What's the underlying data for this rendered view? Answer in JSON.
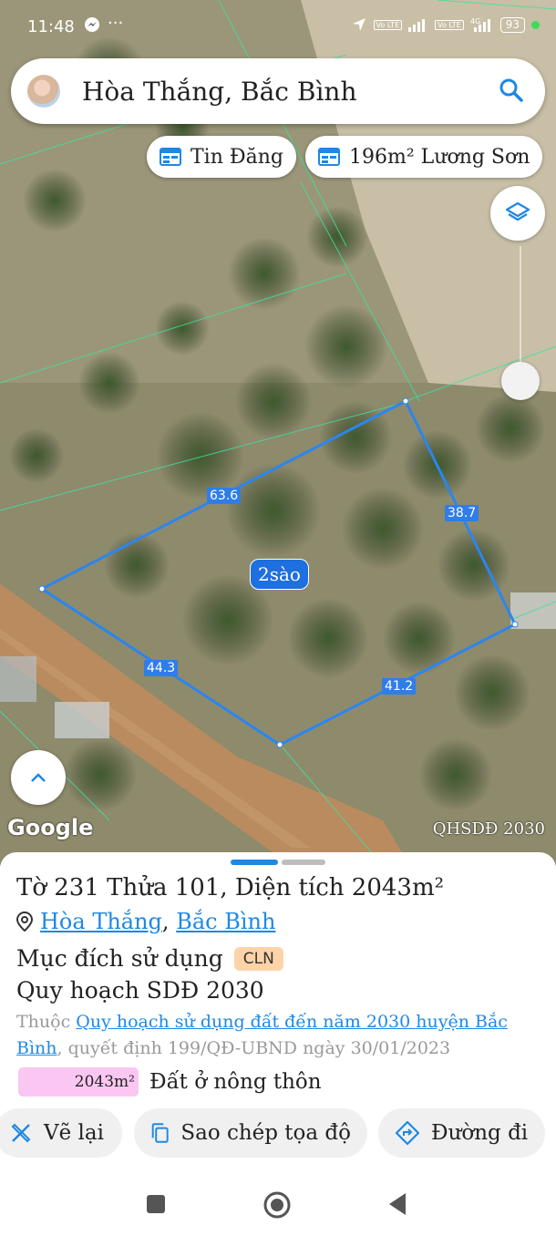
{
  "status_bar": {
    "time": "11:48",
    "battery": "93"
  },
  "search": {
    "query": "Hòa Thắng, Bắc Bình"
  },
  "chips": [
    {
      "label": "Tin Đăng"
    },
    {
      "label": "196m² Lương Sơn"
    }
  ],
  "map": {
    "edges": [
      "63.6",
      "38.7",
      "44.3",
      "41.2"
    ],
    "area_label": "2sào",
    "attribution": "Google",
    "layer_name": "QHSDĐ 2030"
  },
  "parcel": {
    "title": "Tờ 231 Thửa 101, Diện tích 2043m²",
    "commune": "Hòa Thắng",
    "separator": ",",
    "district": "Bắc Bình",
    "purpose_label": "Mục đích sử dụng",
    "purpose_code": "CLN",
    "plan_title": "Quy hoạch SDĐ 2030",
    "plan_prefix": "Thuộc",
    "plan_link": "Quy hoạch sử dụng đất đến năm 2030 huyện Bắc Bình",
    "plan_suffix": ", quyết định 199/QĐ-UBND ngày 30/01/2023",
    "legend_area": "2043m²",
    "legend_label": "Đất ở nông thôn",
    "legend_color": "#f9c7f2"
  },
  "actions": [
    {
      "label": "Vẽ lại"
    },
    {
      "label": "Sao chép tọa độ"
    },
    {
      "label": "Đường đi"
    }
  ]
}
